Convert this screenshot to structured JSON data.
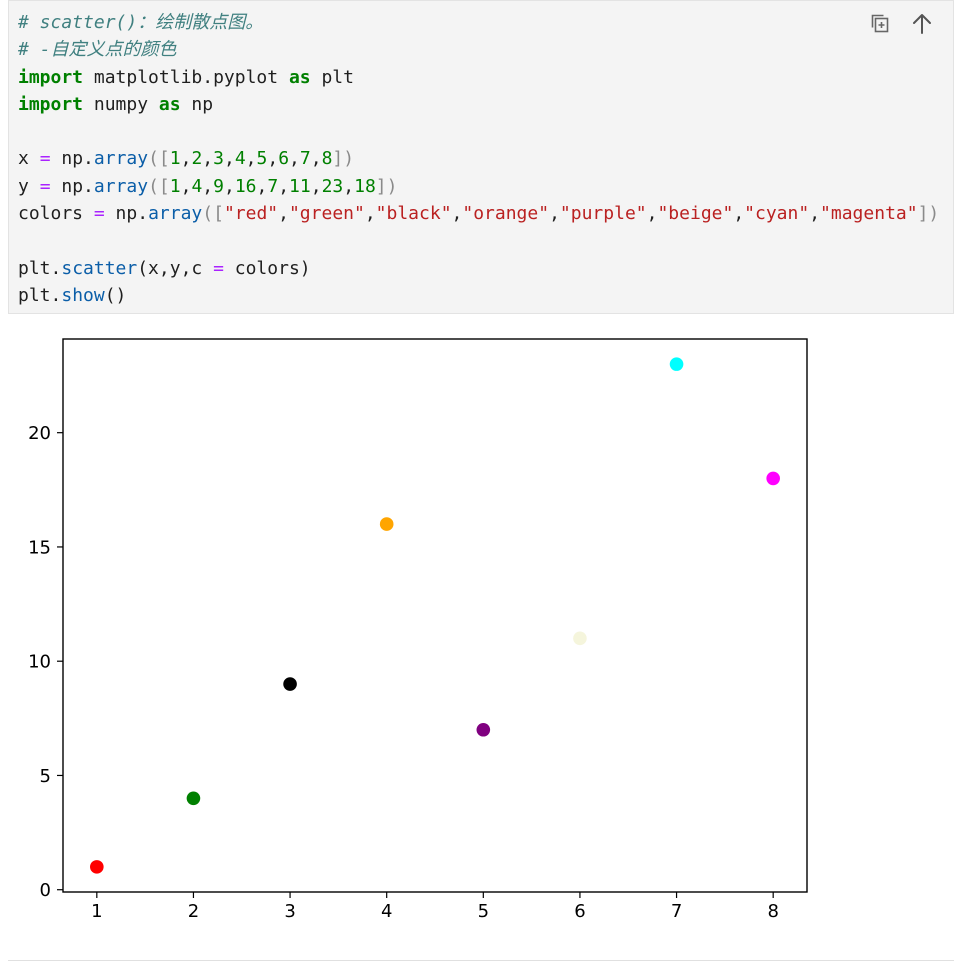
{
  "code_lines": [
    {
      "tokens": [
        {
          "t": "# scatter()：绘制散点图。",
          "c": "cm"
        }
      ]
    },
    {
      "tokens": [
        {
          "t": "# -自定义点的颜色",
          "c": "cm"
        }
      ]
    },
    {
      "tokens": [
        {
          "t": "import",
          "c": "kw"
        },
        {
          "t": " matplotlib.pyplot "
        },
        {
          "t": "as",
          "c": "kw"
        },
        {
          "t": " plt"
        }
      ]
    },
    {
      "tokens": [
        {
          "t": "import",
          "c": "kw"
        },
        {
          "t": " numpy "
        },
        {
          "t": "as",
          "c": "kw"
        },
        {
          "t": " np"
        }
      ]
    },
    {
      "tokens": []
    },
    {
      "tokens": [
        {
          "t": "x "
        },
        {
          "t": "=",
          "c": "op"
        },
        {
          "t": " np."
        },
        {
          "t": "array",
          "c": "fn"
        },
        {
          "t": "([",
          "c": "br"
        },
        {
          "t": "1",
          "c": "num"
        },
        {
          "t": ","
        },
        {
          "t": "2",
          "c": "num"
        },
        {
          "t": ","
        },
        {
          "t": "3",
          "c": "num"
        },
        {
          "t": ","
        },
        {
          "t": "4",
          "c": "num"
        },
        {
          "t": ","
        },
        {
          "t": "5",
          "c": "num"
        },
        {
          "t": ","
        },
        {
          "t": "6",
          "c": "num"
        },
        {
          "t": ","
        },
        {
          "t": "7",
          "c": "num"
        },
        {
          "t": ","
        },
        {
          "t": "8",
          "c": "num"
        },
        {
          "t": "])",
          "c": "br"
        }
      ]
    },
    {
      "tokens": [
        {
          "t": "y "
        },
        {
          "t": "=",
          "c": "op"
        },
        {
          "t": " np."
        },
        {
          "t": "array",
          "c": "fn"
        },
        {
          "t": "([",
          "c": "br"
        },
        {
          "t": "1",
          "c": "num"
        },
        {
          "t": ","
        },
        {
          "t": "4",
          "c": "num"
        },
        {
          "t": ","
        },
        {
          "t": "9",
          "c": "num"
        },
        {
          "t": ","
        },
        {
          "t": "16",
          "c": "num"
        },
        {
          "t": ","
        },
        {
          "t": "7",
          "c": "num"
        },
        {
          "t": ","
        },
        {
          "t": "11",
          "c": "num"
        },
        {
          "t": ","
        },
        {
          "t": "23",
          "c": "num"
        },
        {
          "t": ","
        },
        {
          "t": "18",
          "c": "num"
        },
        {
          "t": "])",
          "c": "br"
        }
      ]
    },
    {
      "tokens": [
        {
          "t": "colors "
        },
        {
          "t": "=",
          "c": "op"
        },
        {
          "t": " np."
        },
        {
          "t": "array",
          "c": "fn"
        },
        {
          "t": "([",
          "c": "br"
        },
        {
          "t": "\"red\"",
          "c": "str"
        },
        {
          "t": ","
        },
        {
          "t": "\"green\"",
          "c": "str"
        },
        {
          "t": ","
        },
        {
          "t": "\"black\"",
          "c": "str"
        },
        {
          "t": ","
        },
        {
          "t": "\"orange\"",
          "c": "str"
        },
        {
          "t": ","
        },
        {
          "t": "\"purple\"",
          "c": "str"
        },
        {
          "t": ","
        },
        {
          "t": "\"beige\"",
          "c": "str"
        },
        {
          "t": ","
        },
        {
          "t": "\"cyan\"",
          "c": "str"
        },
        {
          "t": ","
        },
        {
          "t": "\"magenta\"",
          "c": "str"
        },
        {
          "t": "])",
          "c": "br"
        }
      ]
    },
    {
      "tokens": []
    },
    {
      "tokens": [
        {
          "t": "plt."
        },
        {
          "t": "scatter",
          "c": "fn"
        },
        {
          "t": "(x,y,c "
        },
        {
          "t": "=",
          "c": "op"
        },
        {
          "t": " colors)"
        }
      ]
    },
    {
      "tokens": [
        {
          "t": "plt."
        },
        {
          "t": "show",
          "c": "fn"
        },
        {
          "t": "()"
        }
      ]
    }
  ],
  "toolbar": {
    "copy_icon": "copy-icon",
    "scroll_top_icon": "arrow-up-icon"
  },
  "chart_data": {
    "type": "scatter",
    "title": "",
    "xlabel": "",
    "ylabel": "",
    "x": [
      1,
      2,
      3,
      4,
      5,
      6,
      7,
      8
    ],
    "y": [
      1,
      4,
      9,
      16,
      7,
      11,
      23,
      18
    ],
    "colors": [
      "#ff0000",
      "#008000",
      "#000000",
      "#ffa500",
      "#800080",
      "#f5f5dc",
      "#00ffff",
      "#ff00ff"
    ],
    "xticks": [
      "1",
      "2",
      "3",
      "4",
      "5",
      "6",
      "7",
      "8"
    ],
    "yticks": [
      "0",
      "5",
      "10",
      "15",
      "20"
    ],
    "xlim": [
      0.65,
      8.35
    ],
    "ylim": [
      -0.1,
      24.1
    ],
    "grid": false
  }
}
